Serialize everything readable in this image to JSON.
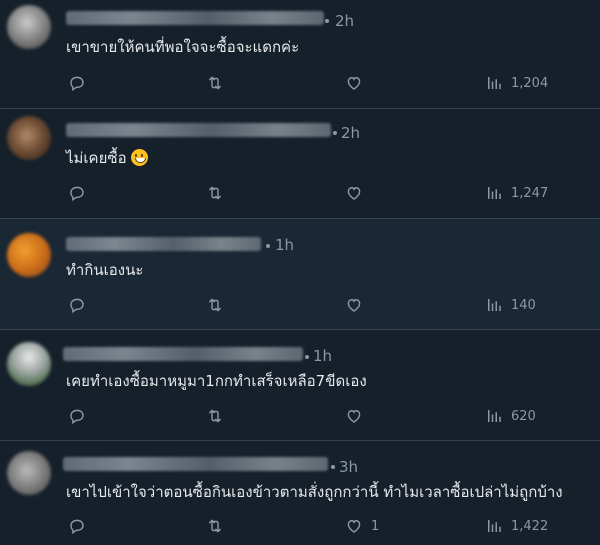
{
  "replies": [
    {
      "time": "2h",
      "text": "เขาขายให้คนที่พอใจจะซื้อจะแดกค่ะ",
      "emoji": false,
      "likes": "",
      "views": "1,204"
    },
    {
      "time": "2h",
      "text": "ไม่เคยซื้อ",
      "emoji": true,
      "likes": "",
      "views": "1,247"
    },
    {
      "time": "1h",
      "text": "ทำกินเองนะ",
      "emoji": false,
      "likes": "",
      "views": "140"
    },
    {
      "time": "1h",
      "text": "เคยทำเองซื้อมาหมูมา1กกทำเสร็จเหลือ7ขีดเอง",
      "emoji": false,
      "likes": "",
      "views": "620"
    },
    {
      "time": "3h",
      "text": "เขาไปเข้าใจว่าตอนซื้อกินเองข้าวตามสั่งถูกกว่านี้ ทำไมเวลาซื้อเปล่าไม่ถูกบ้าง",
      "emoji": false,
      "likes": "1",
      "views": "1,422"
    }
  ],
  "icons": {
    "reply": "reply-icon",
    "retweet": "retweet-icon",
    "like": "like-icon",
    "views": "views-icon"
  },
  "colors": {
    "background": "#15202b",
    "text": "#e7e9ea",
    "muted": "#8b98a5",
    "divider": "#38444d"
  }
}
